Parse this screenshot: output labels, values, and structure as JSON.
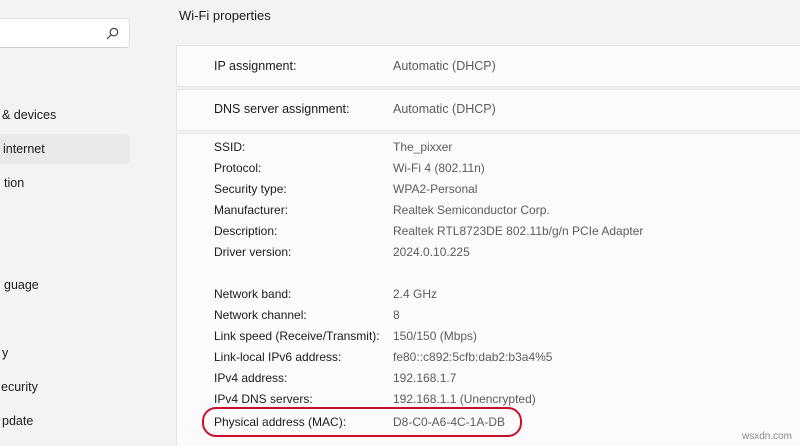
{
  "sidebar": {
    "search": {
      "placeholder": "",
      "value": ""
    },
    "items": [
      {
        "label": "& devices"
      },
      {
        "label": "internet"
      },
      {
        "label": "tion"
      },
      {
        "label": "guage"
      },
      {
        "label": "y"
      },
      {
        "label": "ecurity"
      },
      {
        "label": "pdate"
      }
    ]
  },
  "main": {
    "title": "Wi-Fi properties",
    "ip_assignment": {
      "label": "IP assignment:",
      "value": "Automatic (DHCP)"
    },
    "dns_assignment": {
      "label": "DNS server assignment:",
      "value": "Automatic (DHCP)"
    },
    "properties": [
      {
        "label": "SSID:",
        "value": "The_pixxer"
      },
      {
        "label": "Protocol:",
        "value": "Wi-Fi 4 (802.11n)"
      },
      {
        "label": "Security type:",
        "value": "WPA2-Personal"
      },
      {
        "label": "Manufacturer:",
        "value": "Realtek Semiconductor Corp."
      },
      {
        "label": "Description:",
        "value": "Realtek RTL8723DE 802.11b/g/n PCIe Adapter"
      },
      {
        "label": "Driver version:",
        "value": "2024.0.10.225"
      },
      {
        "label": "Network band:",
        "value": "2.4 GHz"
      },
      {
        "label": "Network channel:",
        "value": "8"
      },
      {
        "label": "Link speed (Receive/Transmit):",
        "value": "150/150 (Mbps)"
      },
      {
        "label": "Link-local IPv6 address:",
        "value": "fe80::c892:5cfb:dab2:b3a4%5"
      },
      {
        "label": "IPv4 address:",
        "value": "192.168.1.7"
      },
      {
        "label": "IPv4 DNS servers:",
        "value": "192.168.1.1 (Unencrypted)"
      },
      {
        "label": "Physical address (MAC):",
        "value": "D8-C0-A6-4C-1A-DB"
      }
    ]
  },
  "watermark": "wsxdn.com",
  "colors": {
    "highlight": "#c8102e",
    "panel": "#fbfbfb",
    "background": "#f3f3f3"
  }
}
